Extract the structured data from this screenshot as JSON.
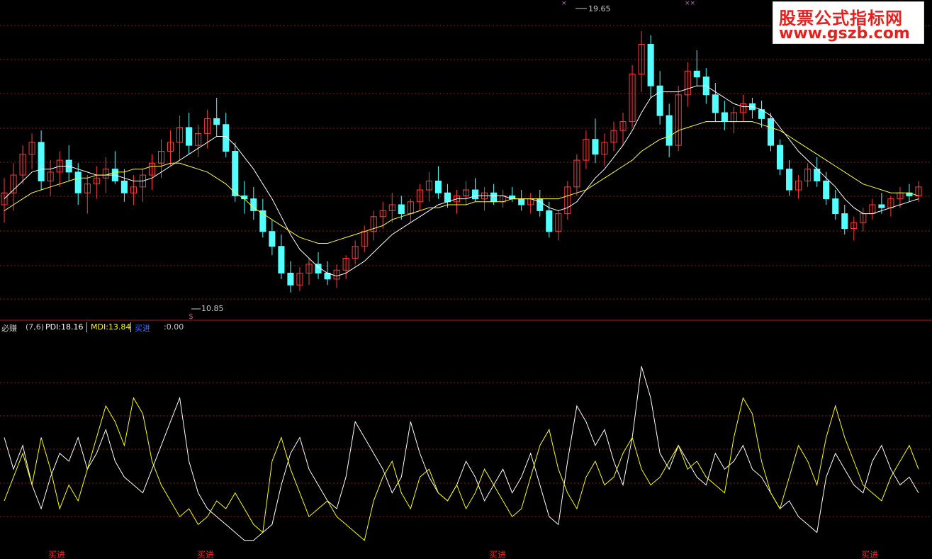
{
  "watermark": {
    "line1": "股票公式指标网",
    "line2": "www.gszb.com"
  },
  "price_panel": {
    "high_label": "19.65",
    "low_label": "10.85",
    "low_marker": "$",
    "colors": {
      "up": "#ff3b3b",
      "down": "#54ffff",
      "ma_short": "#ffffff",
      "ma_long": "#ffff33",
      "grid": "#8b1a1a",
      "divider": "#b01c1c"
    }
  },
  "indicator": {
    "name": "必赚",
    "params": "(7,6)",
    "pdi_label": "PDI:18.16",
    "mdi_label": "MDI:13.84",
    "buy_label": "买进",
    "zero_label": ":0.00",
    "signal_text": "买进",
    "colors": {
      "pdi": "#ffffff",
      "mdi": "#ffff00",
      "signal": "#ff2020",
      "buy_header": "#3b6cff"
    }
  },
  "chart_data": {
    "type": "candlestick",
    "y_range": [
      10.2,
      20.5
    ],
    "candles": [
      [
        13.8,
        14.7,
        13.2,
        14.2
      ],
      [
        14.2,
        15.2,
        13.6,
        14.8
      ],
      [
        14.8,
        15.8,
        14.5,
        15.5
      ],
      [
        15.5,
        16.2,
        15.0,
        15.9
      ],
      [
        15.9,
        16.3,
        14.3,
        14.6
      ],
      [
        14.6,
        15.3,
        14.1,
        14.9
      ],
      [
        14.9,
        15.6,
        14.4,
        15.3
      ],
      [
        15.3,
        15.8,
        14.6,
        14.9
      ],
      [
        14.9,
        15.2,
        13.8,
        14.2
      ],
      [
        14.2,
        14.8,
        13.5,
        14.5
      ],
      [
        14.5,
        15.1,
        14.0,
        14.7
      ],
      [
        14.7,
        15.4,
        14.2,
        15.0
      ],
      [
        15.0,
        15.6,
        14.5,
        14.6
      ],
      [
        14.6,
        15.0,
        13.9,
        14.2
      ],
      [
        14.2,
        14.8,
        13.8,
        14.4
      ],
      [
        14.4,
        15.0,
        13.9,
        14.8
      ],
      [
        14.8,
        15.5,
        14.3,
        15.2
      ],
      [
        15.2,
        16.0,
        14.7,
        15.6
      ],
      [
        15.6,
        16.3,
        15.1,
        15.9
      ],
      [
        15.9,
        16.8,
        15.3,
        16.4
      ],
      [
        16.4,
        16.9,
        15.5,
        15.8
      ],
      [
        15.8,
        16.5,
        15.4,
        16.2
      ],
      [
        16.2,
        17.0,
        15.7,
        16.7
      ],
      [
        16.7,
        17.4,
        16.1,
        16.5
      ],
      [
        16.5,
        16.9,
        15.4,
        15.6
      ],
      [
        15.6,
        15.9,
        13.9,
        14.1
      ],
      [
        14.1,
        14.6,
        13.5,
        14.0
      ],
      [
        14.0,
        14.4,
        13.3,
        13.6
      ],
      [
        13.6,
        14.0,
        12.7,
        12.9
      ],
      [
        12.9,
        13.3,
        12.1,
        12.4
      ],
      [
        12.4,
        12.8,
        11.3,
        11.5
      ],
      [
        11.5,
        11.9,
        10.85,
        11.1
      ],
      [
        11.1,
        11.7,
        10.9,
        11.5
      ],
      [
        11.5,
        12.0,
        11.1,
        11.8
      ],
      [
        11.8,
        12.2,
        11.3,
        11.5
      ],
      [
        11.5,
        11.9,
        11.1,
        11.3
      ],
      [
        11.3,
        11.8,
        11.0,
        11.6
      ],
      [
        11.6,
        12.1,
        11.3,
        12.0
      ],
      [
        12.0,
        12.6,
        11.8,
        12.4
      ],
      [
        12.4,
        13.1,
        12.2,
        12.9
      ],
      [
        12.9,
        13.6,
        12.6,
        13.4
      ],
      [
        13.4,
        13.9,
        13.0,
        13.6
      ],
      [
        13.6,
        14.2,
        13.2,
        13.8
      ],
      [
        13.8,
        14.1,
        13.3,
        13.5
      ],
      [
        13.5,
        14.0,
        13.2,
        13.9
      ],
      [
        13.9,
        14.5,
        13.6,
        14.3
      ],
      [
        14.3,
        14.9,
        13.9,
        14.6
      ],
      [
        14.6,
        15.1,
        14.0,
        14.2
      ],
      [
        14.2,
        14.5,
        13.7,
        13.9
      ],
      [
        13.9,
        14.3,
        13.5,
        14.1
      ],
      [
        14.1,
        14.6,
        13.8,
        14.3
      ],
      [
        14.3,
        14.7,
        13.9,
        14.0
      ],
      [
        14.0,
        14.4,
        13.6,
        14.2
      ],
      [
        14.2,
        14.5,
        13.8,
        13.9
      ],
      [
        13.9,
        14.3,
        13.7,
        14.1
      ],
      [
        14.1,
        14.4,
        13.9,
        14.0
      ],
      [
        14.0,
        14.3,
        13.6,
        13.8
      ],
      [
        13.8,
        14.2,
        13.5,
        14.0
      ],
      [
        14.0,
        14.3,
        13.4,
        13.6
      ],
      [
        13.6,
        13.9,
        12.7,
        12.9
      ],
      [
        12.9,
        13.6,
        12.6,
        13.5
      ],
      [
        13.5,
        14.6,
        13.3,
        14.4
      ],
      [
        14.4,
        15.5,
        14.1,
        15.3
      ],
      [
        15.3,
        16.3,
        15.0,
        16.0
      ],
      [
        16.0,
        16.7,
        15.2,
        15.5
      ],
      [
        15.5,
        16.2,
        15.1,
        15.9
      ],
      [
        15.9,
        16.6,
        15.6,
        16.3
      ],
      [
        16.3,
        16.9,
        15.8,
        16.6
      ],
      [
        16.6,
        18.5,
        16.4,
        18.2
      ],
      [
        18.2,
        19.65,
        17.6,
        19.2
      ],
      [
        19.2,
        19.5,
        17.4,
        17.8
      ],
      [
        17.8,
        18.3,
        16.5,
        16.8
      ],
      [
        16.8,
        17.2,
        15.4,
        15.8
      ],
      [
        15.8,
        17.8,
        15.6,
        17.5
      ],
      [
        17.5,
        18.6,
        17.1,
        18.3
      ],
      [
        18.3,
        19.0,
        17.8,
        18.1
      ],
      [
        18.1,
        18.4,
        17.2,
        17.5
      ],
      [
        17.5,
        17.9,
        16.6,
        16.9
      ],
      [
        16.9,
        17.3,
        16.3,
        16.6
      ],
      [
        16.6,
        17.1,
        16.2,
        16.9
      ],
      [
        16.9,
        17.5,
        16.6,
        17.2
      ],
      [
        17.2,
        17.4,
        16.7,
        17.0
      ],
      [
        17.0,
        17.3,
        16.4,
        16.7
      ],
      [
        16.7,
        16.9,
        15.6,
        15.8
      ],
      [
        15.8,
        16.0,
        14.8,
        15.0
      ],
      [
        15.0,
        15.3,
        14.1,
        14.3
      ],
      [
        14.3,
        14.8,
        14.0,
        14.6
      ],
      [
        14.6,
        15.2,
        14.4,
        15.0
      ],
      [
        15.0,
        15.4,
        14.4,
        14.6
      ],
      [
        14.6,
        14.9,
        13.8,
        14.0
      ],
      [
        14.0,
        14.3,
        13.3,
        13.5
      ],
      [
        13.5,
        13.8,
        12.8,
        13.0
      ],
      [
        13.0,
        13.4,
        12.6,
        13.2
      ],
      [
        13.2,
        13.7,
        12.9,
        13.5
      ],
      [
        13.5,
        14.0,
        13.3,
        13.8
      ],
      [
        13.8,
        14.2,
        13.5,
        13.7
      ],
      [
        13.7,
        14.1,
        13.4,
        14.0
      ],
      [
        14.0,
        14.4,
        13.7,
        14.2
      ],
      [
        14.2,
        14.5,
        13.9,
        14.1
      ],
      [
        14.1,
        14.6,
        13.9,
        14.4
      ]
    ],
    "ma_short": [
      14.0,
      14.3,
      14.6,
      14.9,
      15.0,
      15.0,
      15.1,
      15.1,
      15.0,
      14.9,
      14.8,
      14.8,
      14.8,
      14.7,
      14.6,
      14.6,
      14.7,
      14.9,
      15.1,
      15.3,
      15.5,
      15.7,
      15.9,
      16.1,
      16.1,
      15.8,
      15.4,
      15.0,
      14.5,
      14.0,
      13.4,
      12.8,
      12.3,
      12.0,
      11.7,
      11.5,
      11.4,
      11.5,
      11.7,
      11.9,
      12.2,
      12.5,
      12.8,
      13.0,
      13.2,
      13.4,
      13.6,
      13.8,
      13.9,
      14.0,
      14.0,
      14.1,
      14.1,
      14.1,
      14.1,
      14.0,
      14.0,
      14.0,
      13.9,
      13.7,
      13.6,
      13.7,
      13.9,
      14.3,
      14.7,
      15.0,
      15.4,
      15.8,
      16.3,
      16.9,
      17.4,
      17.6,
      17.6,
      17.6,
      17.7,
      17.8,
      17.8,
      17.6,
      17.4,
      17.2,
      17.1,
      17.1,
      17.0,
      16.8,
      16.4,
      16.0,
      15.6,
      15.3,
      15.0,
      14.7,
      14.4,
      14.0,
      13.7,
      13.5,
      13.5,
      13.6,
      13.7,
      13.8,
      13.9,
      14.0
    ],
    "ma_long": [
      13.6,
      13.8,
      14.0,
      14.2,
      14.3,
      14.4,
      14.5,
      14.6,
      14.7,
      14.7,
      14.8,
      14.8,
      14.9,
      14.9,
      15.0,
      15.0,
      15.1,
      15.1,
      15.2,
      15.2,
      15.1,
      15.0,
      14.9,
      14.7,
      14.5,
      14.2,
      14.0,
      13.7,
      13.5,
      13.3,
      13.1,
      12.9,
      12.7,
      12.6,
      12.5,
      12.5,
      12.6,
      12.7,
      12.8,
      12.9,
      13.0,
      13.1,
      13.3,
      13.4,
      13.5,
      13.6,
      13.7,
      13.7,
      13.8,
      13.8,
      13.8,
      13.9,
      13.9,
      13.9,
      13.9,
      14.0,
      14.0,
      14.0,
      14.0,
      14.0,
      14.0,
      14.1,
      14.2,
      14.3,
      14.5,
      14.7,
      14.9,
      15.1,
      15.3,
      15.6,
      15.8,
      16.0,
      16.1,
      16.3,
      16.4,
      16.5,
      16.6,
      16.6,
      16.6,
      16.6,
      16.6,
      16.6,
      16.5,
      16.4,
      16.3,
      16.1,
      15.9,
      15.7,
      15.5,
      15.3,
      15.1,
      14.9,
      14.7,
      14.5,
      14.4,
      14.3,
      14.2,
      14.2,
      14.2,
      14.1
    ],
    "pdi": [
      30,
      22,
      28,
      18,
      12,
      20,
      26,
      24,
      30,
      22,
      26,
      32,
      24,
      20,
      18,
      16,
      22,
      28,
      34,
      40,
      24,
      16,
      12,
      10,
      8,
      6,
      4,
      4,
      6,
      8,
      18,
      26,
      30,
      22,
      18,
      14,
      12,
      20,
      34,
      30,
      26,
      22,
      16,
      20,
      34,
      26,
      20,
      16,
      14,
      18,
      24,
      20,
      14,
      18,
      22,
      16,
      20,
      26,
      18,
      10,
      8,
      24,
      38,
      34,
      28,
      32,
      24,
      18,
      30,
      48,
      40,
      26,
      22,
      28,
      24,
      20,
      18,
      26,
      22,
      24,
      28,
      22,
      20,
      16,
      12,
      14,
      10,
      8,
      6,
      20,
      26,
      22,
      18,
      16,
      24,
      28,
      22,
      18,
      20,
      16
    ],
    "mdi": [
      14,
      20,
      26,
      18,
      30,
      22,
      12,
      18,
      14,
      22,
      30,
      38,
      34,
      28,
      40,
      36,
      24,
      18,
      14,
      10,
      12,
      8,
      10,
      14,
      12,
      16,
      12,
      8,
      6,
      24,
      30,
      22,
      16,
      10,
      12,
      14,
      10,
      8,
      6,
      4,
      14,
      20,
      24,
      16,
      12,
      20,
      22,
      16,
      14,
      18,
      12,
      16,
      22,
      18,
      14,
      10,
      12,
      20,
      28,
      32,
      22,
      16,
      12,
      20,
      24,
      18,
      20,
      26,
      30,
      22,
      18,
      20,
      24,
      28,
      22,
      24,
      20,
      18,
      16,
      30,
      40,
      36,
      24,
      16,
      12,
      20,
      28,
      24,
      18,
      30,
      38,
      30,
      24,
      18,
      16,
      14,
      20,
      24,
      28,
      22
    ],
    "signal_positions": [
      10,
      40,
      97,
      172
    ]
  }
}
